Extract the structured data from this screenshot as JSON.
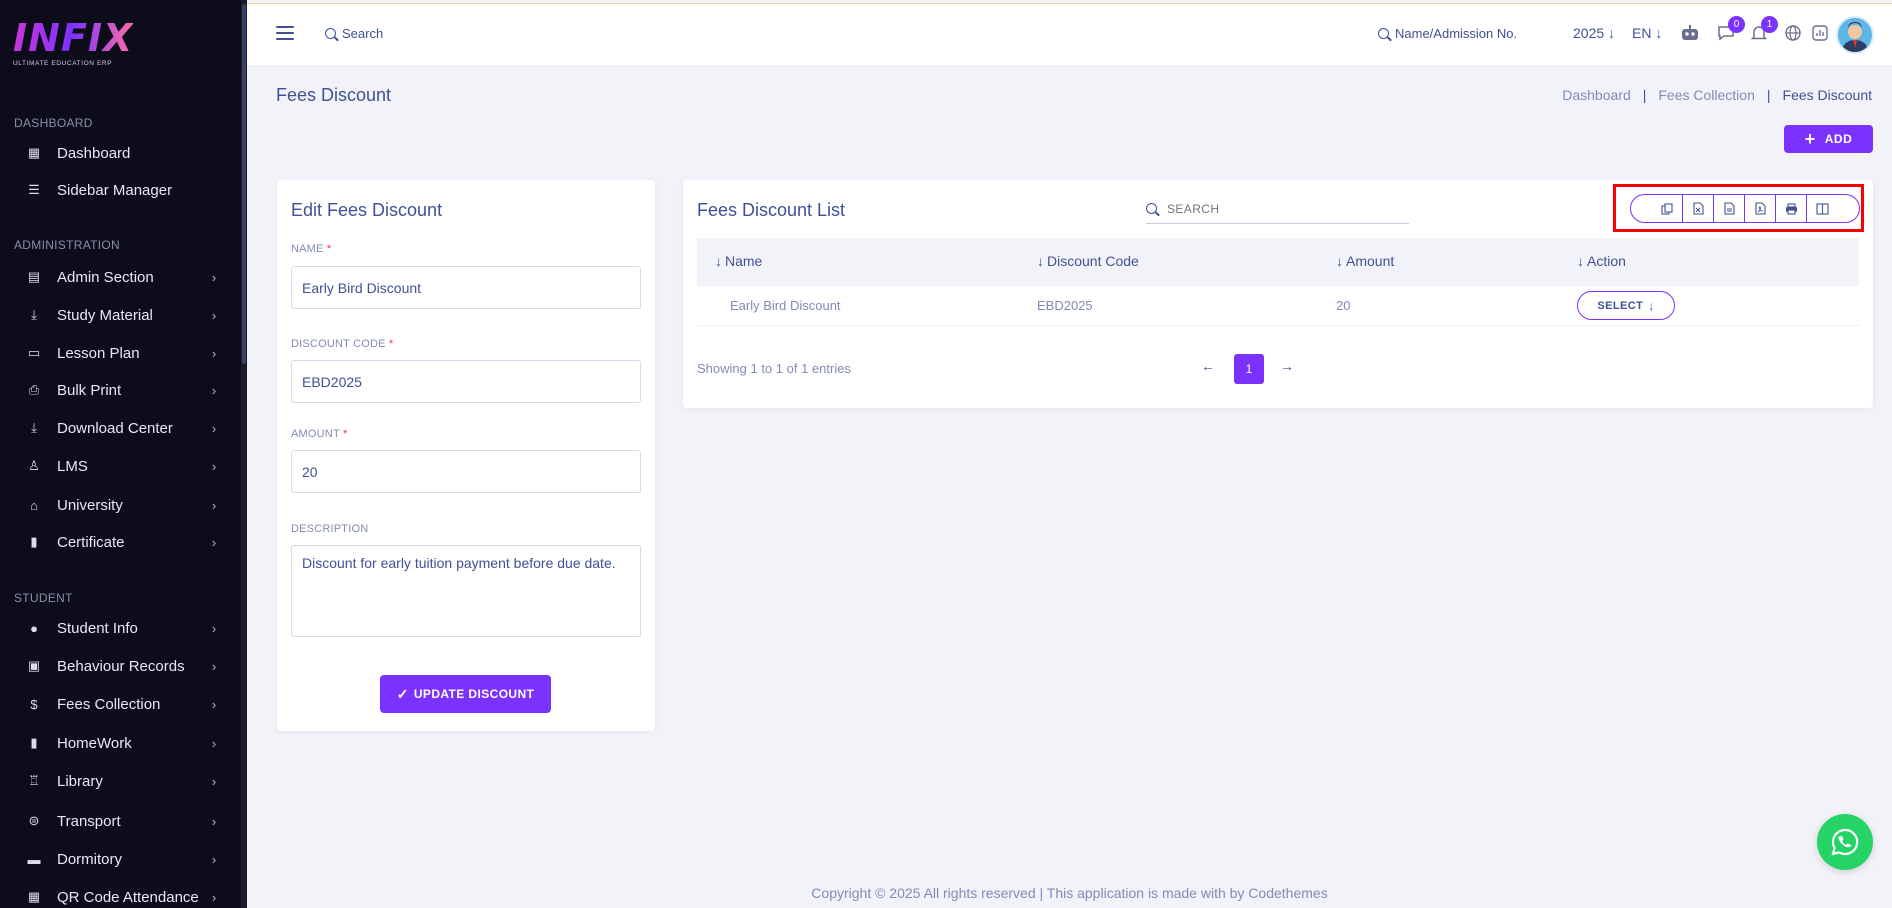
{
  "brand": {
    "logo_text": "INFIX",
    "logo_sub": "ULTIMATE EDUCATION ERP"
  },
  "sidebar": {
    "sections": [
      {
        "label": "DASHBOARD"
      },
      {
        "label": "ADMINISTRATION"
      },
      {
        "label": "STUDENT"
      }
    ],
    "items": [
      {
        "label": "Dashboard",
        "icon": "grid-icon",
        "glyph": "▦",
        "chevron": false
      },
      {
        "label": "Sidebar Manager",
        "icon": "list-icon",
        "glyph": "☰",
        "chevron": false
      },
      {
        "label": "Admin Section",
        "icon": "admin-icon",
        "glyph": "▤",
        "chevron": true
      },
      {
        "label": "Study Material",
        "icon": "download-icon",
        "glyph": "⤓",
        "chevron": true
      },
      {
        "label": "Lesson Plan",
        "icon": "lesson-icon",
        "glyph": "▭",
        "chevron": true
      },
      {
        "label": "Bulk Print",
        "icon": "print-icon",
        "glyph": "⎙",
        "chevron": true
      },
      {
        "label": "Download Center",
        "icon": "download-center-icon",
        "glyph": "⤓",
        "chevron": true
      },
      {
        "label": "LMS",
        "icon": "lms-icon",
        "glyph": "♙",
        "chevron": true
      },
      {
        "label": "University",
        "icon": "university-icon",
        "glyph": "⌂",
        "chevron": true
      },
      {
        "label": "Certificate",
        "icon": "certificate-icon",
        "glyph": "▮",
        "chevron": true
      },
      {
        "label": "Student Info",
        "icon": "student-icon",
        "glyph": "●",
        "chevron": true
      },
      {
        "label": "Behaviour Records",
        "icon": "behaviour-icon",
        "glyph": "▣",
        "chevron": true
      },
      {
        "label": "Fees Collection",
        "icon": "fees-icon",
        "glyph": "$",
        "chevron": true
      },
      {
        "label": "HomeWork",
        "icon": "homework-icon",
        "glyph": "▮",
        "chevron": true
      },
      {
        "label": "Library",
        "icon": "library-icon",
        "glyph": "♖",
        "chevron": true
      },
      {
        "label": "Transport",
        "icon": "transport-icon",
        "glyph": "⊜",
        "chevron": true
      },
      {
        "label": "Dormitory",
        "icon": "dormitory-icon",
        "glyph": "▬",
        "chevron": true
      },
      {
        "label": "QR Code Attendance",
        "icon": "qr-icon",
        "glyph": "▦",
        "chevron": true
      }
    ]
  },
  "header": {
    "search_label": "Search",
    "admission_search": "Name/Admission No.",
    "year": "2025",
    "language": "EN",
    "messages_count": "0",
    "notifications_count": "1"
  },
  "page": {
    "title": "Fees Discount",
    "breadcrumb": [
      "Dashboard",
      "Fees Collection",
      "Fees Discount"
    ],
    "add_label": "ADD"
  },
  "edit_form": {
    "title": "Edit Fees Discount",
    "name_label": "NAME",
    "name_value": "Early Bird Discount",
    "code_label": "DISCOUNT CODE",
    "code_value": "EBD2025",
    "amount_label": "AMOUNT",
    "amount_value": "20",
    "description_label": "DESCRIPTION",
    "description_value": "Discount for early tuition payment before due date.",
    "required_mark": "*",
    "submit_label": "UPDATE DISCOUNT"
  },
  "list": {
    "title": "Fees Discount List",
    "search_placeholder": "SEARCH",
    "columns": [
      "Name",
      "Discount Code",
      "Amount",
      "Action"
    ],
    "rows": [
      {
        "name": "Early Bird Discount",
        "code": "EBD2025",
        "amount": "20",
        "action": "SELECT"
      }
    ],
    "entries_text": "Showing 1 to 1 of 1 entries",
    "current_page": "1",
    "tools": [
      "copy-icon",
      "excel-icon",
      "csv-icon",
      "pdf-icon",
      "print-icon",
      "columns-icon"
    ]
  },
  "footer": {
    "text": "Copyright © 2025 All rights reserved | This application is made with by Codethemes"
  },
  "colors": {
    "accent": "#7c32ff",
    "sidebar_bg": "#0c0c1b",
    "text": "#415094",
    "muted": "#828bb2",
    "highlight": "#ff0000"
  }
}
